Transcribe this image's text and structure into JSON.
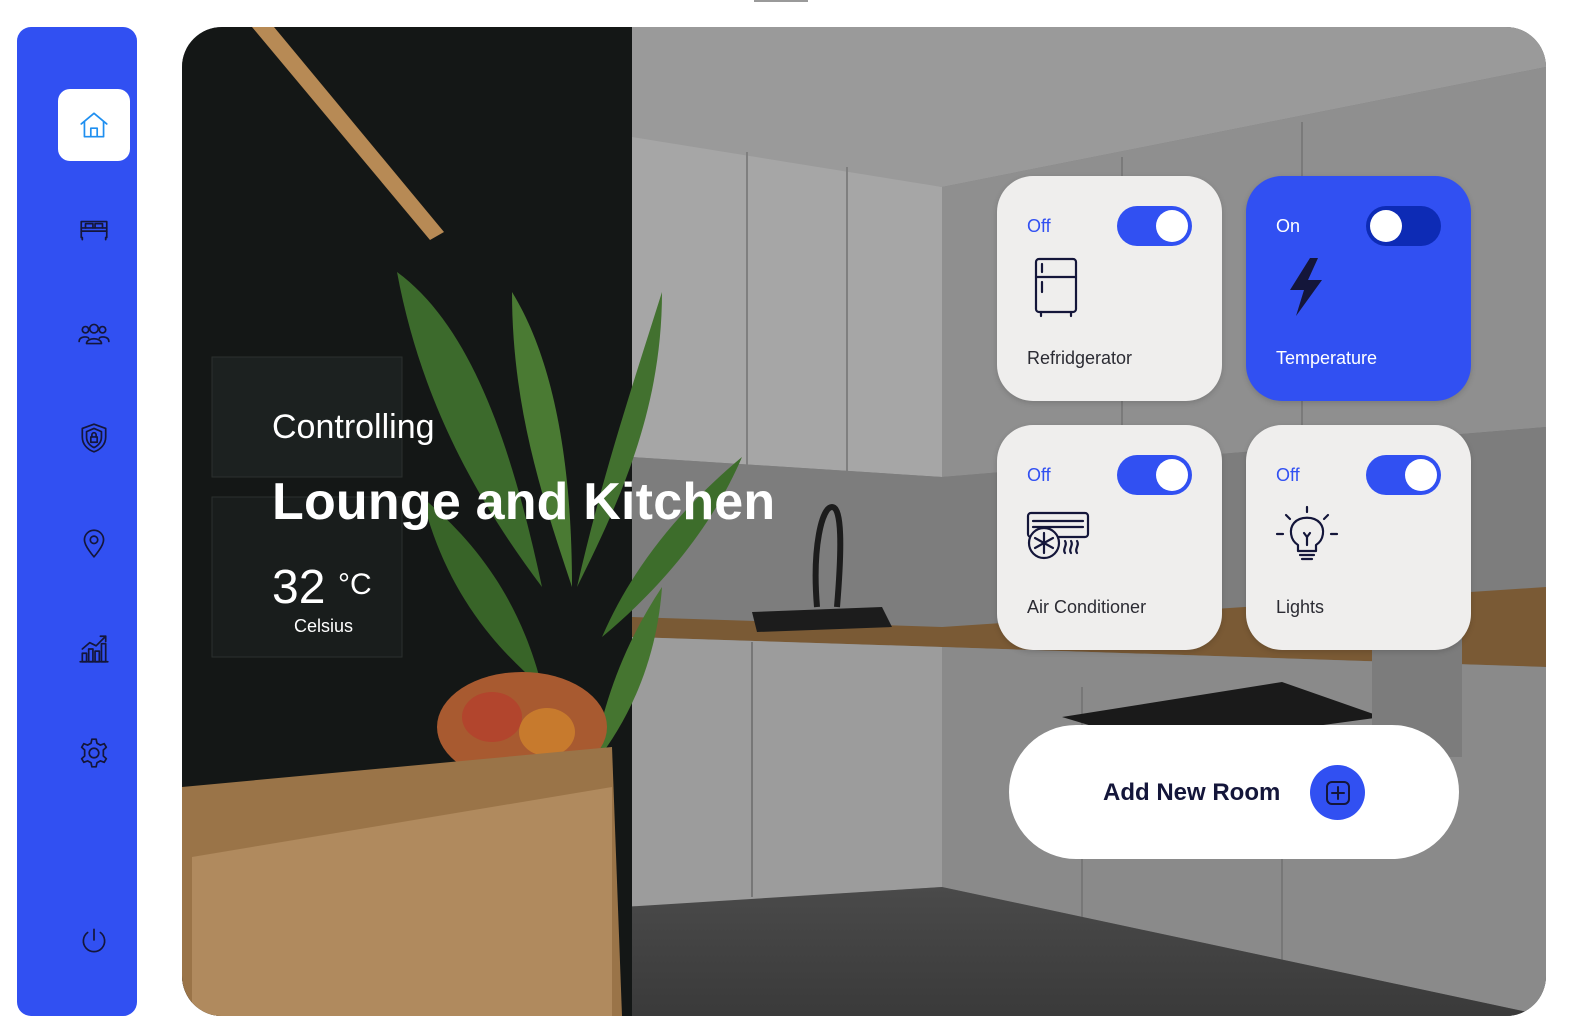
{
  "sidebar": {
    "items": [
      {
        "icon": "home-icon",
        "active": true
      },
      {
        "icon": "bed-icon",
        "active": false
      },
      {
        "icon": "users-icon",
        "active": false
      },
      {
        "icon": "security-shield-icon",
        "active": false
      },
      {
        "icon": "location-pin-icon",
        "active": false
      },
      {
        "icon": "analytics-icon",
        "active": false
      },
      {
        "icon": "gear-icon",
        "active": false
      }
    ],
    "power_icon": "power-icon",
    "accent_color": "#3150f2",
    "active_icon_color": "#1f8ff0"
  },
  "hero": {
    "subtitle": "Controlling",
    "title": "Lounge and Kitchen",
    "temperature": "32",
    "temperature_unit": "°C",
    "temperature_label": "Celsius"
  },
  "devices": [
    {
      "name": "Refridgerator",
      "state": "Off",
      "icon": "refrigerator-icon"
    },
    {
      "name": "Temperature",
      "state": "On",
      "icon": "lightning-icon"
    },
    {
      "name": "Air Conditioner",
      "state": "Off",
      "icon": "air-conditioner-icon"
    },
    {
      "name": "Lights",
      "state": "Off",
      "icon": "light-bulb-icon"
    }
  ],
  "add_room": {
    "label": "Add New Room",
    "icon": "add-square-icon"
  },
  "colors": {
    "card_off_bg": "#efeeed",
    "card_on_bg": "#3150f2",
    "toggle_on_card": "#0d2bb5",
    "text_dark": "#14163a"
  }
}
